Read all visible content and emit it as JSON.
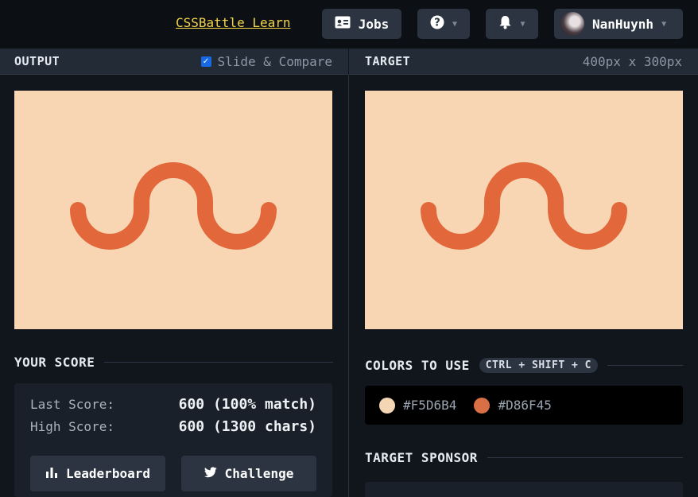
{
  "header": {
    "learn_link": "CSSBattle Learn",
    "jobs_label": "Jobs",
    "username": "NanHuynh"
  },
  "output": {
    "title": "OUTPUT",
    "slide_compare_label": "Slide & Compare",
    "slide_compare_checked": true
  },
  "target": {
    "title": "TARGET",
    "dimensions": "400px x 300px"
  },
  "canvas": {
    "background": "#F9D6B3",
    "stroke": "#E2673A"
  },
  "score": {
    "title": "YOUR SCORE",
    "last_label": "Last Score:",
    "last_value": "600 (100% match)",
    "high_label": "High Score:",
    "high_value": "600 (1300 chars)",
    "leaderboard_label": "Leaderboard",
    "challenge_label": "Challenge"
  },
  "colors": {
    "title": "COLORS TO USE",
    "shortcut": "CTRL + SHIFT + C",
    "items": [
      {
        "hex": "#F5D6B4"
      },
      {
        "hex": "#D86F45"
      }
    ]
  },
  "sponsor": {
    "title": "TARGET SPONSOR"
  }
}
